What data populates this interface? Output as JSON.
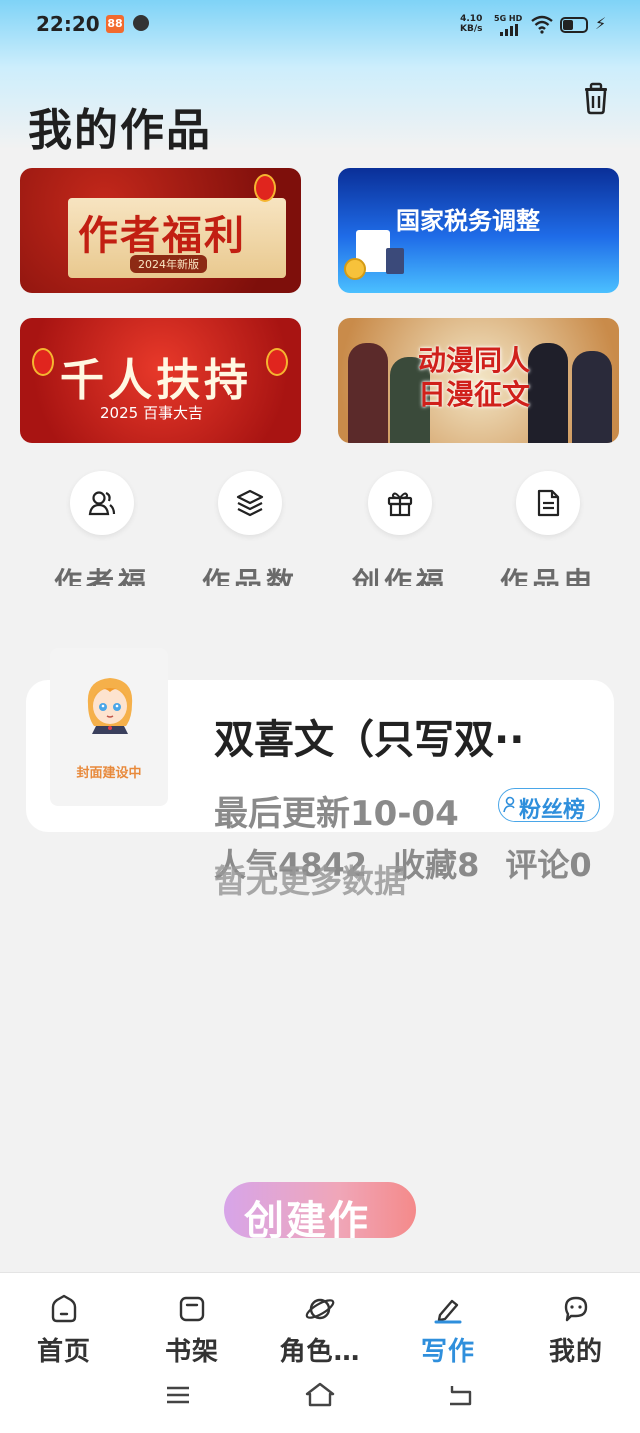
{
  "status": {
    "time": "22:20",
    "speed_top": "4.10",
    "speed_unit": "KB/s",
    "network": "5G HD"
  },
  "header": {
    "title": "我的作品"
  },
  "banners": [
    {
      "title": "作者福利",
      "subtitle": "2024年新版"
    },
    {
      "title": "国家税务调整"
    },
    {
      "title": "千人扶持",
      "subtitle": "2025 百事大吉"
    },
    {
      "title_line1": "动漫同人",
      "title_line2": "日漫征文"
    }
  ],
  "actions": [
    {
      "label": "作者福",
      "icon": "users-icon"
    },
    {
      "label": "作品数",
      "icon": "layers-icon"
    },
    {
      "label": "创作福",
      "icon": "gift-icon"
    },
    {
      "label": "作品申",
      "icon": "document-icon"
    }
  ],
  "work": {
    "cover_label": "封面建设中",
    "title": "双喜文（只写双··",
    "updated": "最后更新10-04",
    "fans_badge": "粉丝榜",
    "stats": {
      "popularity": "人气4842",
      "favorites": "收藏8",
      "comments": "评论0"
    }
  },
  "empty_text": "暂无更多数据",
  "create_button": "创建作",
  "tabs": [
    {
      "label": "首页",
      "icon": "home-icon"
    },
    {
      "label": "书架",
      "icon": "bookshelf-icon"
    },
    {
      "label": "角色…",
      "icon": "planet-icon"
    },
    {
      "label": "写作",
      "icon": "pen-icon",
      "active": true
    },
    {
      "label": "我的",
      "icon": "message-icon"
    }
  ],
  "colors": {
    "accent": "#2f8fdc",
    "background": "#f2f2f2"
  }
}
